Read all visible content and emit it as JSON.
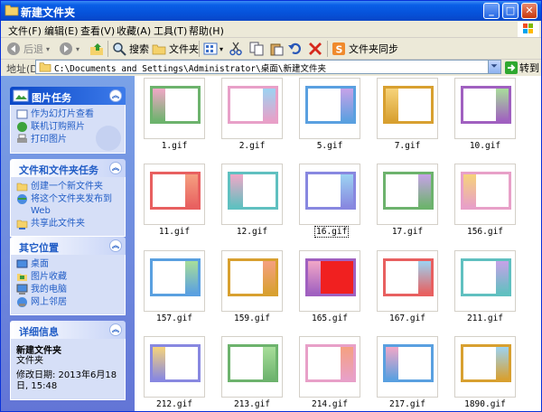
{
  "window": {
    "title": "新建文件夹"
  },
  "menu": [
    "文件(F)",
    "编辑(E)",
    "查看(V)",
    "收藏(A)",
    "工具(T)",
    "帮助(H)"
  ],
  "toolbar": {
    "back": "后退",
    "search": "搜索",
    "folders": "文件夹",
    "sync": "文件夹同步"
  },
  "address": {
    "label": "地址(D)",
    "path": "C:\\Documents and Settings\\Administrator\\桌面\\新建文件夹",
    "go": "转到"
  },
  "panels": {
    "picture_tasks": {
      "title": "图片任务",
      "items": [
        "作为幻灯片查看",
        "联机订购照片",
        "打印图片"
      ]
    },
    "file_tasks": {
      "title": "文件和文件夹任务",
      "items": [
        "创建一个新文件夹",
        "将这个文件夹发布到 Web",
        "共享此文件夹"
      ]
    },
    "other_places": {
      "title": "其它位置",
      "items": [
        "桌面",
        "图片收藏",
        "我的电脑",
        "网上邻居"
      ]
    },
    "details": {
      "title": "详细信息",
      "name": "新建文件夹",
      "type": "文件夹",
      "modified": "修改日期: 2013年6月18日, 15:48"
    }
  },
  "files": [
    {
      "name": "1.gif"
    },
    {
      "name": "2.gif"
    },
    {
      "name": "5.gif"
    },
    {
      "name": "7.gif"
    },
    {
      "name": "10.gif"
    },
    {
      "name": "11.gif"
    },
    {
      "name": "12.gif"
    },
    {
      "name": "16.gif",
      "selected": true
    },
    {
      "name": "17.gif"
    },
    {
      "name": "156.gif"
    },
    {
      "name": "157.gif"
    },
    {
      "name": "159.gif"
    },
    {
      "name": "165.gif"
    },
    {
      "name": "167.gif"
    },
    {
      "name": "211.gif"
    },
    {
      "name": "212.gif"
    },
    {
      "name": "213.gif"
    },
    {
      "name": "214.gif"
    },
    {
      "name": "217.gif"
    },
    {
      "name": "1890.gif"
    }
  ],
  "colors": {
    "titlebar": "#0A5FE7",
    "taskpane": "#6F8EE0",
    "link": "#215DC6"
  }
}
